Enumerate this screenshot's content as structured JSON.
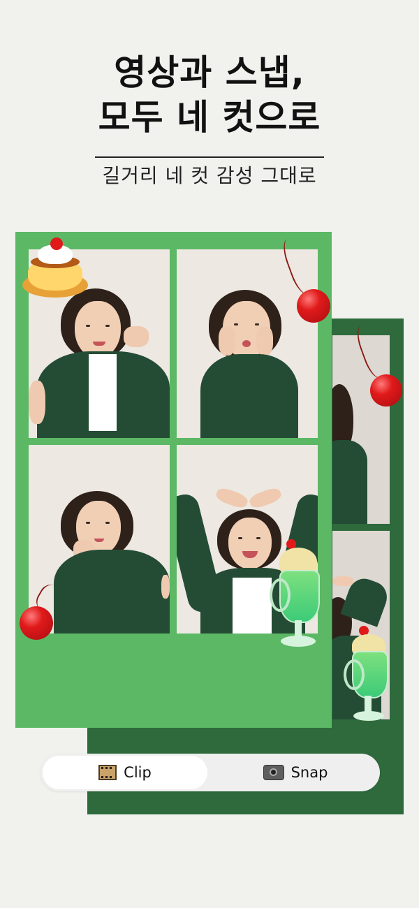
{
  "hero": {
    "headline_line1": "영상과 스냅,",
    "headline_line2": "모두 네 컷으로",
    "subtitle": "길거리 네 컷 감성 그대로"
  },
  "mode_toggle": {
    "options": [
      {
        "label": "Clip",
        "icon": "film-icon",
        "selected": true
      },
      {
        "label": "Snap",
        "icon": "camera-icon",
        "selected": false
      }
    ]
  },
  "colors": {
    "background": "#f1f2ee",
    "frame_green": "#5cb865",
    "frame_dark_green": "#2e6a3c"
  }
}
